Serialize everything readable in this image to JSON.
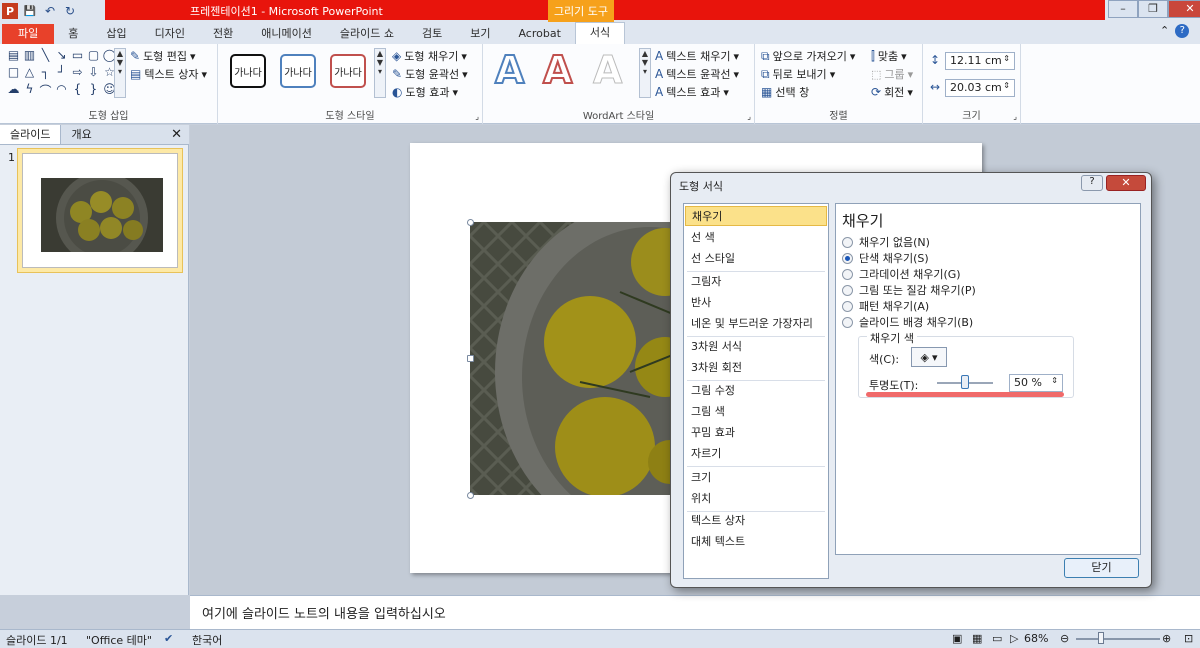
{
  "window": {
    "title": "프레젠테이션1 - Microsoft PowerPoint",
    "context_tab": "그리기 도구",
    "minimize": "–",
    "restore": "❐",
    "close": "✕"
  },
  "qat": {
    "save": "💾",
    "undo": "↶",
    "redo": "↻"
  },
  "tabs": [
    "파일",
    "홈",
    "삽입",
    "디자인",
    "전환",
    "애니메이션",
    "슬라이드 쇼",
    "검토",
    "보기",
    "Acrobat",
    "서식"
  ],
  "ribbon": {
    "shape_insert": {
      "label": "도형 삽입",
      "edit": "도형 편집",
      "textbox": "텍스트 상자"
    },
    "shape_styles": {
      "label": "도형 스타일",
      "preset": "가나다",
      "fill": "도형 채우기",
      "outline": "도형 윤곽선",
      "effects": "도형 효과"
    },
    "wordart": {
      "label": "WordArt 스타일",
      "letter": "A",
      "text_fill": "텍스트 채우기",
      "text_outline": "텍스트 윤곽선",
      "text_effects": "텍스트 효과"
    },
    "arrange": {
      "label": "정렬",
      "bring_forward": "앞으로 가져오기",
      "send_backward": "뒤로 보내기",
      "selection_pane": "선택 창",
      "align": "맞춤",
      "group": "그룹",
      "rotate": "회전"
    },
    "size": {
      "label": "크기",
      "height": "12.11 cm",
      "width": "20.03 cm"
    }
  },
  "left_pane": {
    "tab_slides": "슬라이드",
    "tab_outline": "개요",
    "close": "✕",
    "slide_number": "1"
  },
  "notes": {
    "placeholder": "여기에 슬라이드 노트의 내용을 입력하십시오"
  },
  "status": {
    "slide": "슬라이드 1/1",
    "theme": "\"Office 테마\"",
    "language": "한국어",
    "zoom": "68%"
  },
  "dialog": {
    "title": "도형 서식",
    "help": "?",
    "close_x": "✕",
    "categories": [
      "채우기",
      "선 색",
      "선 스타일",
      "그림자",
      "반사",
      "네온 및 부드러운 가장자리",
      "3차원 서식",
      "3차원 회전",
      "그림 수정",
      "그림 색",
      "꾸밈 효과",
      "자르기",
      "크기",
      "위치",
      "텍스트 상자",
      "대체 텍스트"
    ],
    "selected_category": "채우기",
    "panel_title": "채우기",
    "options": [
      "채우기 없음(N)",
      "단색 채우기(S)",
      "그라데이션 채우기(G)",
      "그림 또는 질감 채우기(P)",
      "패턴 채우기(A)",
      "슬라이드 배경 채우기(B)"
    ],
    "selected_option": "단색 채우기(S)",
    "fill_color_title": "채우기 색",
    "color_label": "색(C):",
    "transparency_label": "투명도(T):",
    "transparency_value": "50 %",
    "transparency_fraction": 0.5,
    "close_button": "닫기"
  }
}
